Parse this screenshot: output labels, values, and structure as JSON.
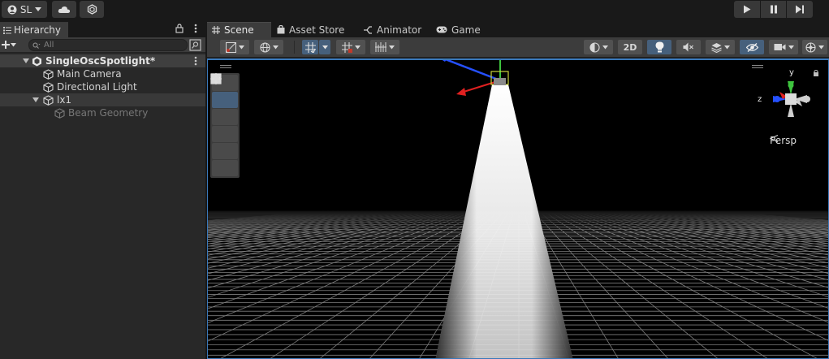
{
  "topbar": {
    "account_label": "SL",
    "icons": [
      "account-icon",
      "cloud-icon",
      "collab-icon",
      "play-icon",
      "pause-icon",
      "step-icon"
    ]
  },
  "hierarchy": {
    "tab_label": "Hierarchy",
    "search_placeholder": "All",
    "scene_name": "SingleOscSpotlight*",
    "items": [
      {
        "label": "Main Camera"
      },
      {
        "label": "Directional Light"
      },
      {
        "label": "lx1"
      },
      {
        "label": "Beam Geometry"
      }
    ]
  },
  "scene_tabs": [
    {
      "label": "Scene"
    },
    {
      "label": "Asset Store"
    },
    {
      "label": "Animator"
    },
    {
      "label": "Game"
    }
  ],
  "scene_toolbar": {
    "mode_2d_label": "2D"
  },
  "viewport": {
    "projection_label": "Persp",
    "gizmo_axes": {
      "x": "x",
      "y": "y",
      "z": "z"
    },
    "colors": {
      "x_axis": "#e02020",
      "y_axis": "#3ec43e",
      "z_axis": "#2550ff",
      "selection_border": "#3a79bb",
      "active_tool": "#46607c"
    }
  }
}
